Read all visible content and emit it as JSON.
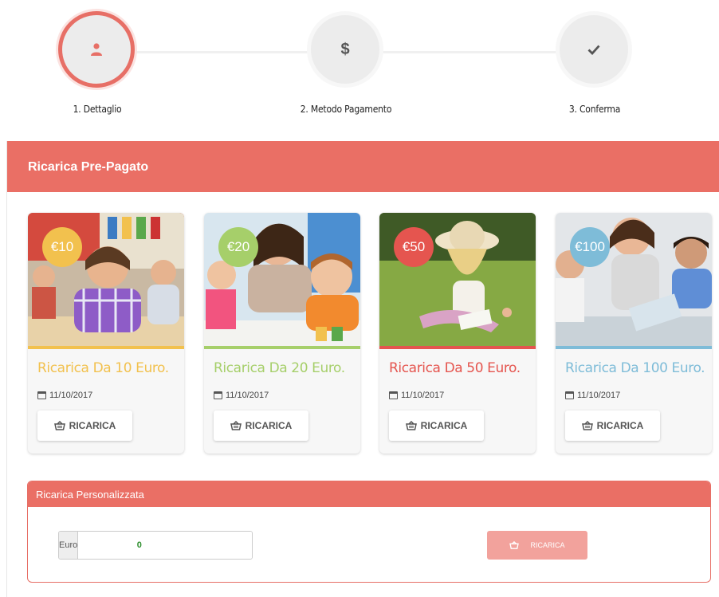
{
  "stepper": {
    "steps": [
      {
        "label": "1. Dettaglio",
        "icon": "user-icon",
        "active": true
      },
      {
        "label": "2. Metodo Pagamento",
        "icon": "dollar-icon",
        "active": false
      },
      {
        "label": "3. Conferma",
        "icon": "check-icon",
        "active": false
      }
    ]
  },
  "section": {
    "title": "Ricarica Pre-Pagato"
  },
  "cards": [
    {
      "badge": "€10",
      "title": "Ricarica Da 10 Euro.",
      "date": "11/10/2017",
      "button": "RICARICA",
      "color": "#f2c14e"
    },
    {
      "badge": "€20",
      "title": "Ricarica Da 20 Euro.",
      "date": "11/10/2017",
      "button": "RICARICA",
      "color": "#a6cf6a"
    },
    {
      "badge": "€50",
      "title": "Ricarica Da 50 Euro.",
      "date": "11/10/2017",
      "button": "RICARICA",
      "color": "#e5554f"
    },
    {
      "badge": "€100",
      "title": "Ricarica Da 100 Euro.",
      "date": "11/10/2017",
      "button": "RICARICA",
      "color": "#7ebcd8"
    }
  ],
  "custom": {
    "title": "Ricarica Personalizzata",
    "currency_label": "Euro",
    "amount_value": "0",
    "button": "RICARICA"
  },
  "colors": {
    "accent": "#ea6f65",
    "accent_light": "#f2a29c"
  }
}
